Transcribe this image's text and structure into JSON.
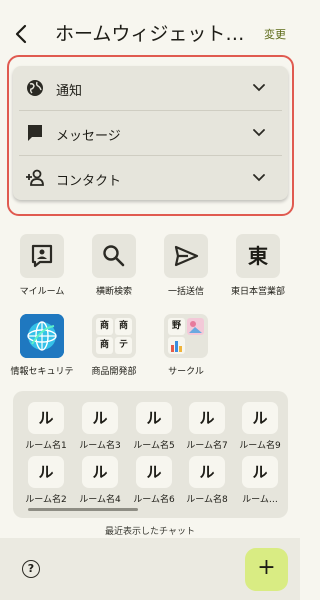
{
  "header": {
    "title": "ホームウィジェット…",
    "edit_label": "変更"
  },
  "categories": [
    {
      "label": "通知",
      "icon": "globe-icon"
    },
    {
      "label": "メッセージ",
      "icon": "flag-message-icon"
    },
    {
      "label": "コンタクト",
      "icon": "add-person-icon"
    }
  ],
  "shortcuts_row1": [
    {
      "label": "マイルーム",
      "icon": "my-room-icon"
    },
    {
      "label": "横断検索",
      "icon": "search-icon"
    },
    {
      "label": "一括送信",
      "icon": "send-icon"
    },
    {
      "label": "東日本営業部",
      "glyph": "東"
    }
  ],
  "shortcuts_row2": [
    {
      "label": "情報セキュリテ",
      "icon": "security-globe-icon"
    },
    {
      "label": "商品開発部",
      "glyphs": [
        "商",
        "商",
        "商",
        "テ"
      ]
    },
    {
      "label": "サークル",
      "glyphs": [
        "野"
      ]
    }
  ],
  "rooms": [
    {
      "glyph": "ル",
      "name": "ルーム名1"
    },
    {
      "glyph": "ル",
      "name": "ルーム名3"
    },
    {
      "glyph": "ル",
      "name": "ルーム名5"
    },
    {
      "glyph": "ル",
      "name": "ルーム名7"
    },
    {
      "glyph": "ル",
      "name": "ルーム名9"
    },
    {
      "glyph": "ル",
      "name": "ルーム名2"
    },
    {
      "glyph": "ル",
      "name": "ルーム名4"
    },
    {
      "glyph": "ル",
      "name": "ルーム名6"
    },
    {
      "glyph": "ル",
      "name": "ルーム名8"
    },
    {
      "glyph": "ル",
      "name": "ルーム…"
    }
  ],
  "recent_label": "最近表示したチャット",
  "footer": {
    "help_glyph": "?",
    "fab_glyph": "+"
  },
  "colors": {
    "highlight": "#e05a50",
    "fab": "#d9ec83",
    "accent": "#5d6b19"
  }
}
